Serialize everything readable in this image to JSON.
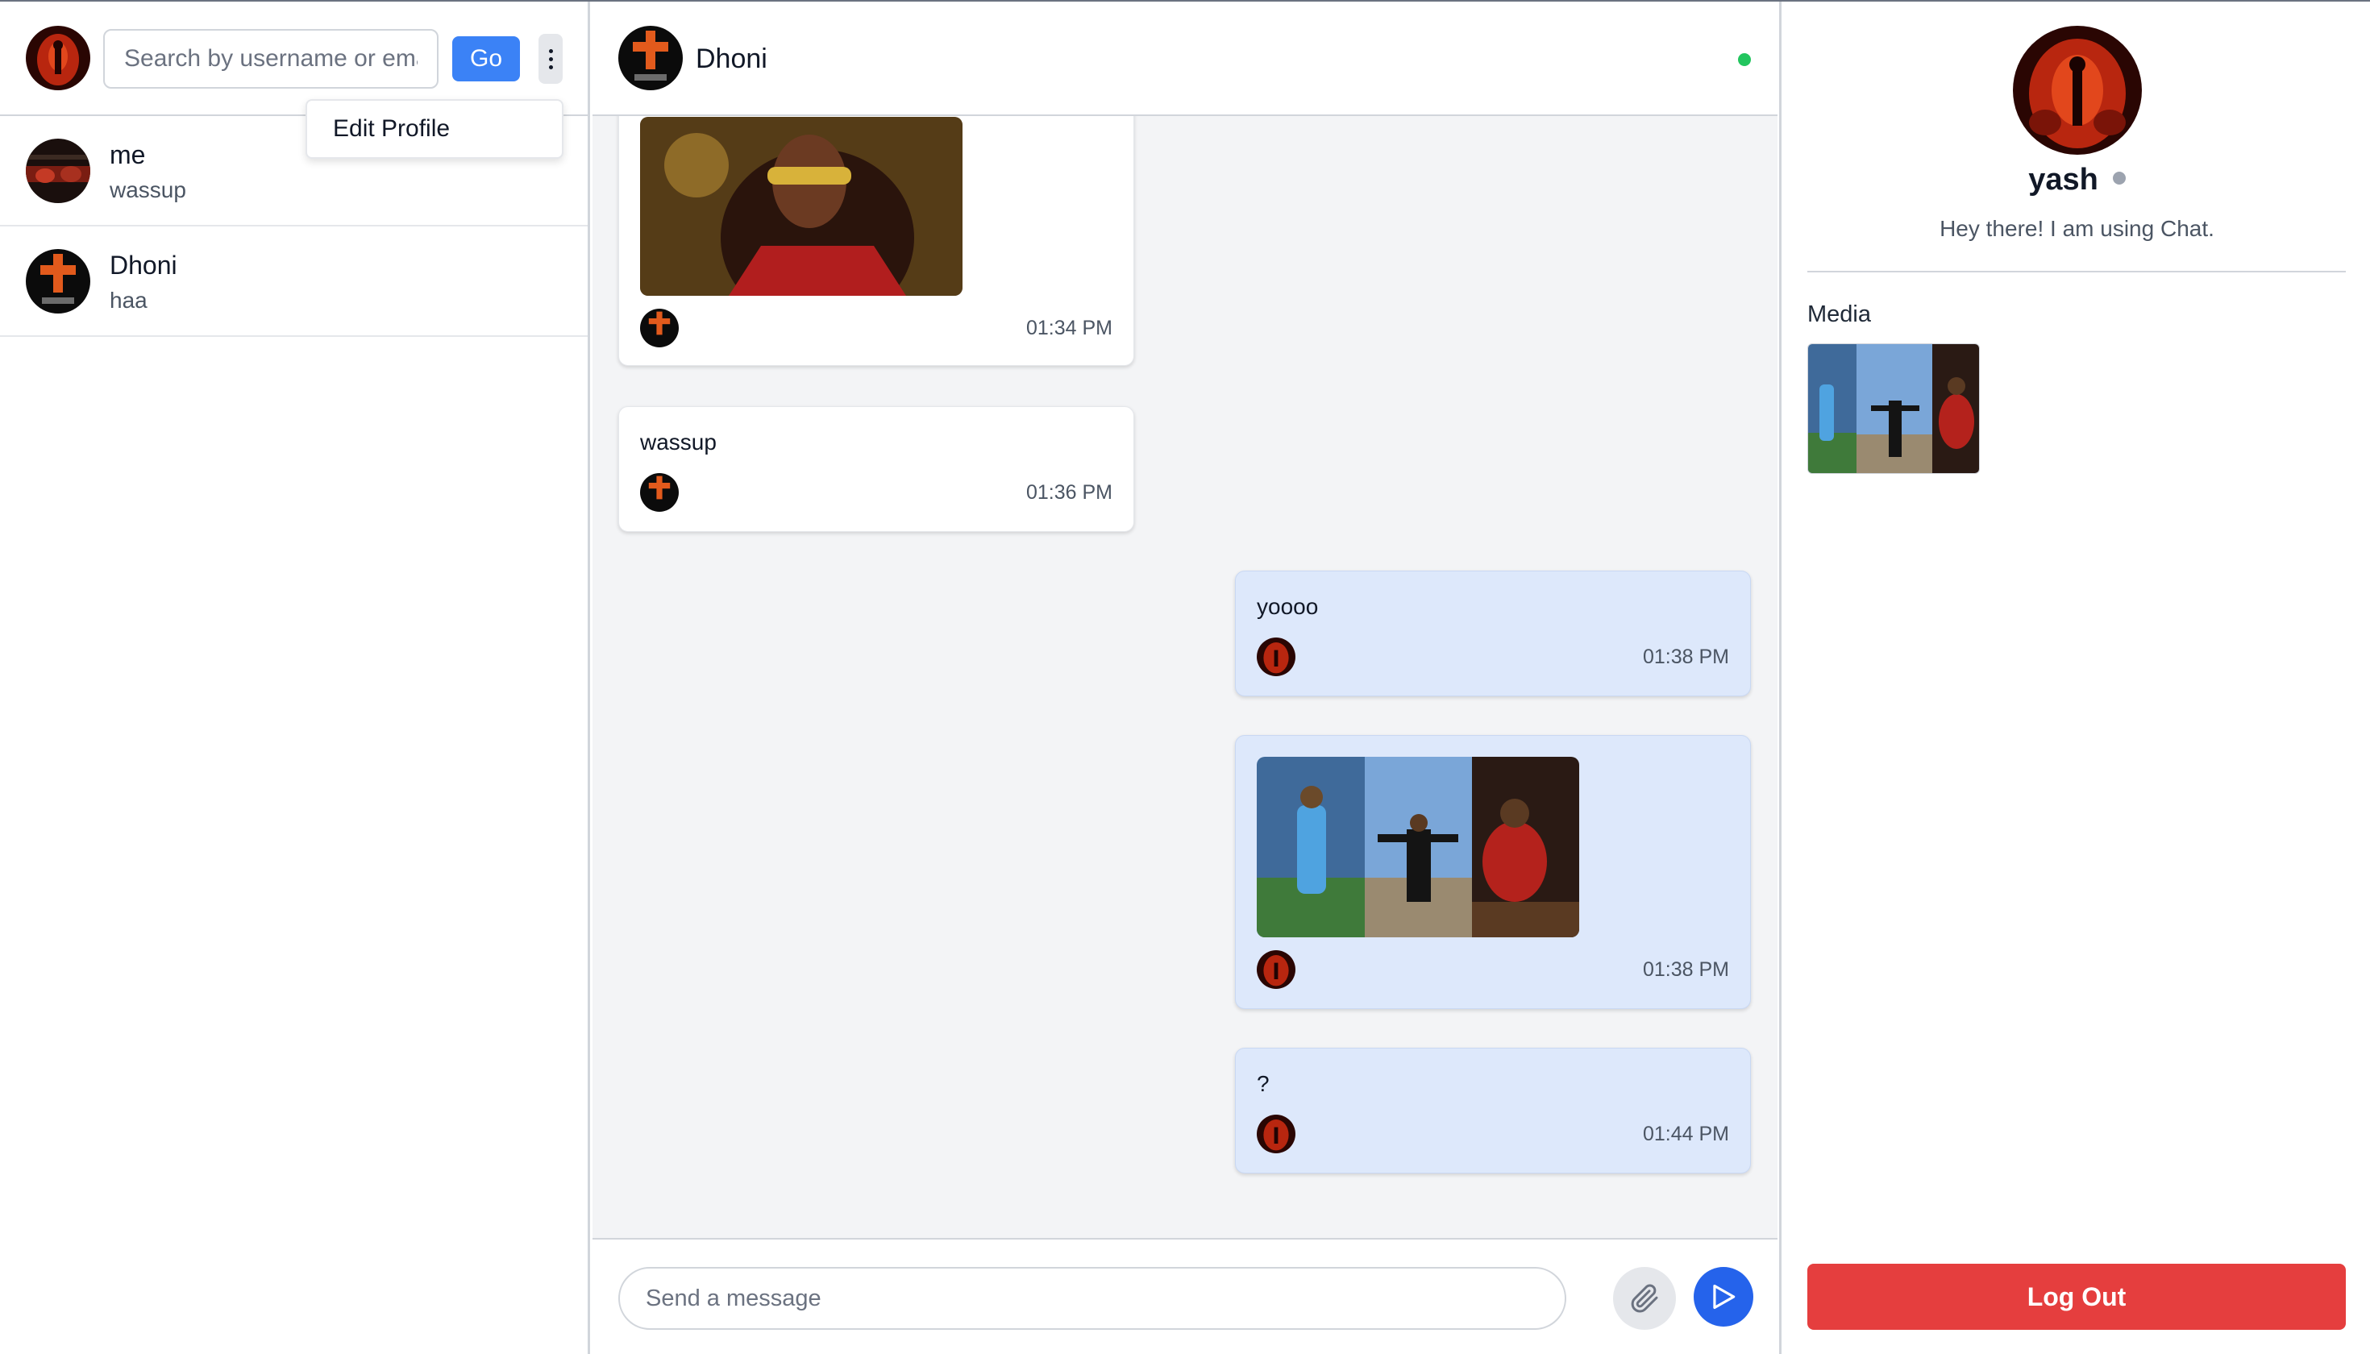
{
  "sidebar": {
    "search": {
      "placeholder": "Search by username or email",
      "button_label": "Go"
    },
    "menu": {
      "items": [
        {
          "label": "Edit Profile"
        }
      ]
    },
    "chats": [
      {
        "name": "me",
        "preview": "wassup"
      },
      {
        "name": "Dhoni",
        "preview": "haa"
      }
    ]
  },
  "chat": {
    "header": {
      "name": "Dhoni",
      "online": true
    },
    "messages": [
      {
        "direction": "incoming",
        "type": "image",
        "time": "01:34 PM"
      },
      {
        "direction": "incoming",
        "type": "text",
        "text": "wassup",
        "time": "01:36 PM"
      },
      {
        "direction": "outgoing",
        "type": "text",
        "text": "yoooo",
        "time": "01:38 PM"
      },
      {
        "direction": "outgoing",
        "type": "image",
        "time": "01:38 PM"
      },
      {
        "direction": "outgoing",
        "type": "text",
        "text": "?",
        "time": "01:44 PM"
      }
    ],
    "composer": {
      "placeholder": "Send a message"
    }
  },
  "profile": {
    "name": "yash",
    "status_text": "Hey there! I am using Chat.",
    "media_label": "Media",
    "logout_label": "Log Out"
  },
  "colors": {
    "accent": "#3b82f6",
    "send": "#2563eb",
    "outgoing_bubble": "#dde8fb",
    "online": "#22c55e",
    "logout": "#e53e3e"
  },
  "icons": [
    "kebab-menu-icon",
    "paperclip-icon",
    "send-icon",
    "online-status-icon"
  ]
}
